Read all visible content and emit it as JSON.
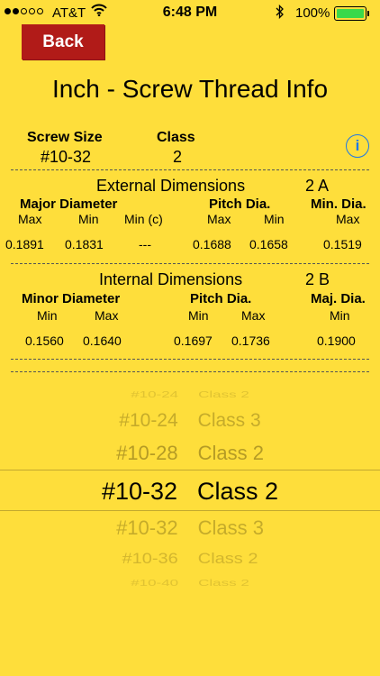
{
  "status_bar": {
    "carrier": "AT&T",
    "time": "6:48 PM",
    "battery": "100%"
  },
  "back_label": "Back",
  "title": "Inch - Screw Thread Info",
  "selection": {
    "size_label": "Screw Size",
    "size_value": "#10-32",
    "class_label": "Class",
    "class_value": "2"
  },
  "info_icon": "i",
  "external": {
    "title": "External Dimensions",
    "class_code": "2  A",
    "headers": {
      "major": "Major Diameter",
      "pitch": "Pitch Dia.",
      "minor": "Min. Dia."
    },
    "sub": {
      "max1": "Max",
      "min1": "Min",
      "minc": "Min (c)",
      "max2": "Max",
      "min2": "Min",
      "max3": "Max"
    },
    "values": {
      "major_max": "0.1891",
      "major_min": "0.1831",
      "major_minc": "---",
      "pitch_max": "0.1688",
      "pitch_min": "0.1658",
      "minor_max": "0.1519"
    }
  },
  "internal": {
    "title": "Internal Dimensions",
    "class_code": "2  B",
    "headers": {
      "minor": "Minor Diameter",
      "pitch": "Pitch Dia.",
      "major": "Maj. Dia."
    },
    "sub": {
      "min1": "Min",
      "max1": "Max",
      "min2": "Min",
      "max2": "Max",
      "min3": "Min"
    },
    "values": {
      "minor_min": "0.1560",
      "minor_max": "0.1640",
      "pitch_min": "0.1697",
      "pitch_max": "0.1736",
      "major_min": "0.1900"
    }
  },
  "picker": [
    {
      "size": "#10-24",
      "cls": "Class 2"
    },
    {
      "size": "#10-24",
      "cls": "Class 3"
    },
    {
      "size": "#10-28",
      "cls": "Class 2"
    },
    {
      "size": "#10-32",
      "cls": "Class 2"
    },
    {
      "size": "#10-32",
      "cls": "Class 3"
    },
    {
      "size": "#10-36",
      "cls": "Class 2"
    },
    {
      "size": "#10-40",
      "cls": "Class 2"
    }
  ],
  "colors": {
    "background": "#FEDE3B",
    "back_button": "#B11B18",
    "info_icon": "#1E78E6"
  }
}
